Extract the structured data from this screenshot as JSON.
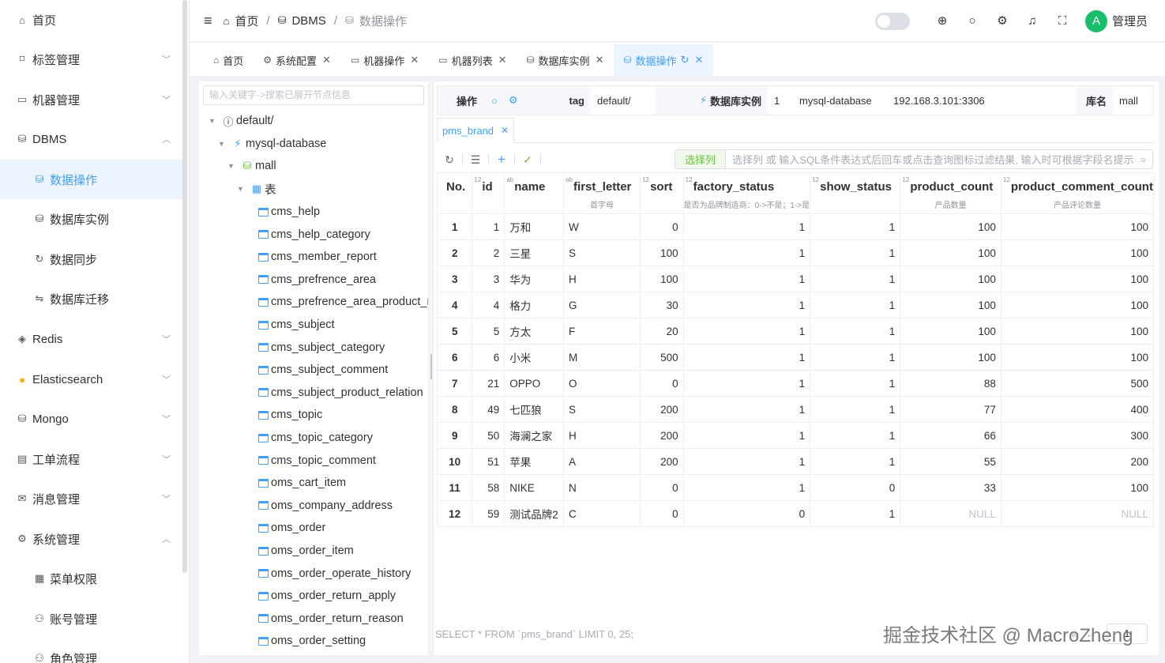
{
  "sidebar": {
    "items": [
      {
        "label": "首页",
        "icon": "home-icon"
      },
      {
        "label": "标签管理",
        "icon": "bookmark-icon"
      },
      {
        "label": "机器管理",
        "icon": "monitor-icon"
      },
      {
        "label": "DBMS",
        "icon": "database-icon"
      },
      {
        "label": "数据操作",
        "icon": "database-icon"
      },
      {
        "label": "数据库实例",
        "icon": "database-icon"
      },
      {
        "label": "数据同步",
        "icon": "sync-icon"
      },
      {
        "label": "数据库迁移",
        "icon": "migrate-icon"
      },
      {
        "label": "Redis",
        "icon": "redis-icon"
      },
      {
        "label": "Elasticsearch",
        "icon": "elasticsearch-icon"
      },
      {
        "label": "Mongo",
        "icon": "mongo-icon"
      },
      {
        "label": "工单流程",
        "icon": "ticket-icon"
      },
      {
        "label": "消息管理",
        "icon": "mail-icon"
      },
      {
        "label": "系统管理",
        "icon": "gear-icon"
      },
      {
        "label": "菜单权限",
        "icon": "grid-icon"
      },
      {
        "label": "账号管理",
        "icon": "user-icon"
      },
      {
        "label": "角色管理",
        "icon": "users-icon"
      }
    ]
  },
  "header": {
    "breadcrumb": [
      "首页",
      "DBMS",
      "数据操作"
    ],
    "username": "管理员",
    "avatar_letter": "A"
  },
  "tabs": [
    {
      "label": "首页",
      "icon": "home-icon"
    },
    {
      "label": "系统配置",
      "icon": "gear-icon"
    },
    {
      "label": "机器操作",
      "icon": "monitor-icon"
    },
    {
      "label": "机器列表",
      "icon": "monitor-icon"
    },
    {
      "label": "数据库实例",
      "icon": "database-icon"
    },
    {
      "label": "数据操作",
      "icon": "database-icon"
    }
  ],
  "tree": {
    "search_placeholder": "输入关键字->搜索已展开节点信息",
    "tag": "default/",
    "instance": "mysql-database",
    "db": "mall",
    "table_group": "表",
    "tables": [
      "cms_help",
      "cms_help_category",
      "cms_member_report",
      "cms_prefrence_area",
      "cms_prefrence_area_product_relation",
      "cms_subject",
      "cms_subject_category",
      "cms_subject_comment",
      "cms_subject_product_relation",
      "cms_topic",
      "cms_topic_category",
      "cms_topic_comment",
      "oms_cart_item",
      "oms_company_address",
      "oms_order",
      "oms_order_item",
      "oms_order_operate_history",
      "oms_order_return_apply",
      "oms_order_return_reason",
      "oms_order_setting"
    ]
  },
  "infobar": {
    "op_label": "操作",
    "tag_label": "tag",
    "tag_value": "default/",
    "instance_label": "数据库实例",
    "instance_id": "1",
    "instance_name": "mysql-database",
    "instance_addr": "192.168.3.101:3306",
    "db_label": "库名",
    "db_value": "mall"
  },
  "query_tab": "pms_brand",
  "filter": {
    "button": "选择列",
    "placeholder": "选择列 或 输入SQL条件表达式后回车或点击查询图标过滤结果, 输入时可根据字段名提示"
  },
  "columns": [
    {
      "name": "No.",
      "type": "",
      "comment": ""
    },
    {
      "name": "id",
      "type": "12",
      "comment": ""
    },
    {
      "name": "name",
      "type": "ab",
      "comment": ""
    },
    {
      "name": "first_letter",
      "type": "ab",
      "comment": "首字母"
    },
    {
      "name": "sort",
      "type": "12",
      "comment": ""
    },
    {
      "name": "factory_status",
      "type": "12",
      "comment": "是否为品牌制造商：0->不是；1->是"
    },
    {
      "name": "show_status",
      "type": "12",
      "comment": ""
    },
    {
      "name": "product_count",
      "type": "12",
      "comment": "产品数量"
    },
    {
      "name": "product_comment_count",
      "type": "12",
      "comment": "产品评论数量"
    }
  ],
  "rows": [
    [
      "1",
      "1",
      "万和",
      "W",
      "0",
      "1",
      "1",
      "100",
      "100"
    ],
    [
      "2",
      "2",
      "三星",
      "S",
      "100",
      "1",
      "1",
      "100",
      "100"
    ],
    [
      "3",
      "3",
      "华为",
      "H",
      "100",
      "1",
      "1",
      "100",
      "100"
    ],
    [
      "4",
      "4",
      "格力",
      "G",
      "30",
      "1",
      "1",
      "100",
      "100"
    ],
    [
      "5",
      "5",
      "方太",
      "F",
      "20",
      "1",
      "1",
      "100",
      "100"
    ],
    [
      "6",
      "6",
      "小米",
      "M",
      "500",
      "1",
      "1",
      "100",
      "100"
    ],
    [
      "7",
      "21",
      "OPPO",
      "O",
      "0",
      "1",
      "1",
      "88",
      "500"
    ],
    [
      "8",
      "49",
      "七匹狼",
      "S",
      "200",
      "1",
      "1",
      "77",
      "400"
    ],
    [
      "9",
      "50",
      "海澜之家",
      "H",
      "200",
      "1",
      "1",
      "66",
      "300"
    ],
    [
      "10",
      "51",
      "苹果",
      "A",
      "200",
      "1",
      "1",
      "55",
      "200"
    ],
    [
      "11",
      "58",
      "NIKE",
      "N",
      "0",
      "1",
      "0",
      "33",
      "100"
    ],
    [
      "12",
      "59",
      "测试品牌2",
      "C",
      "0",
      "0",
      "1",
      "NULL",
      "NULL"
    ]
  ],
  "sql": "SELECT * FROM `pms_brand` LIMIT 0, 25;",
  "pager": {
    "page": "1"
  },
  "watermark": "掘金技术社区 @ MacroZheng"
}
